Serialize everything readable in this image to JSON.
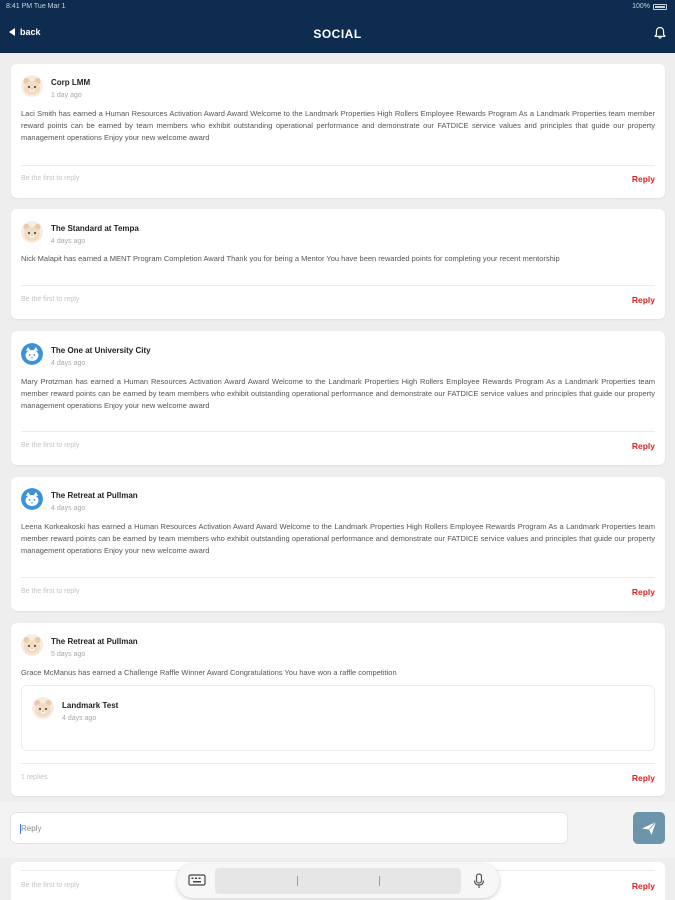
{
  "status_bar": {
    "time": "8:41 PM",
    "date": "Tue Mar 1",
    "battery": "100%"
  },
  "nav": {
    "back_label": "back",
    "title": "SOCIAL"
  },
  "posts": [
    {
      "author": "Corp LMM",
      "time": "1 day ago",
      "avatar": "hamster",
      "body": "Laci Smith has earned a Human Resources Activation Award Award Welcome to the Landmark Properties High Rollers Employee Rewards Program As a Landmark Properties team member reward points can be earned by team members who exhibit outstanding operational performance and demonstrate our FATDICE service values and principles that guide our property management operations Enjoy your new welcome award",
      "replies_note": "Be the first to reply",
      "reply_label": "Reply"
    },
    {
      "author": "The Standard at Tempa",
      "time": "4 days ago",
      "avatar": "hamster",
      "body": "Nick Malapit has earned a MENT Program Completion Award Thank you for being a Mentor You have been rewarded points for completing your recent mentorship",
      "replies_note": "Be the first to reply",
      "reply_label": "Reply"
    },
    {
      "author": "The One at University City",
      "time": "4 days ago",
      "avatar": "cat",
      "body": "Mary Protzman has earned a Human Resources Activation Award Award Welcome to the Landmark Properties High Rollers Employee Rewards Program As a Landmark Properties team member reward points can be earned by team members who exhibit outstanding operational performance and demonstrate our FATDICE service values and principles that guide our property management operations Enjoy your new welcome award",
      "replies_note": "Be the first to reply",
      "reply_label": "Reply"
    },
    {
      "author": "The Retreat at Pullman",
      "time": "4 days ago",
      "avatar": "cat",
      "body": "Leena Korkeakoski has earned a Human Resources Activation Award Award Welcome to the Landmark Properties High Rollers Employee Rewards Program As a Landmark Properties team member reward points can be earned by team members who exhibit outstanding operational performance and demonstrate our FATDICE service values and principles that guide our property management operations Enjoy your new welcome award",
      "replies_note": "Be the first to reply",
      "reply_label": "Reply"
    },
    {
      "author": "The Retreat at Pullman",
      "time": "5 days ago",
      "avatar": "hamster",
      "body": "Grace McManus has earned a Challenge Raffle Winner Award Congratulations You have won a raffle competition",
      "nested_reply": {
        "author": "Landmark Test",
        "time": "4 days ago",
        "avatar": "hamster"
      },
      "replies_note": "1 replies",
      "reply_label": "Reply"
    }
  ],
  "reply_bar": {
    "placeholder": "Reply"
  },
  "bottom_card": {
    "replies_note": "Be the first to reply",
    "reply_label": "Reply"
  },
  "colors": {
    "nav_bg": "#0e2c4f",
    "reply_red": "#e02020",
    "send_button": "#6c94ab",
    "cat_avatar": "#3a93d8",
    "hamster_avatar": "#f3dcc4"
  },
  "icons": {
    "back": "back-arrow-icon",
    "bell": "bell-icon",
    "send": "paper-plane-icon",
    "keyboard": "keyboard-icon",
    "mic": "microphone-icon"
  }
}
